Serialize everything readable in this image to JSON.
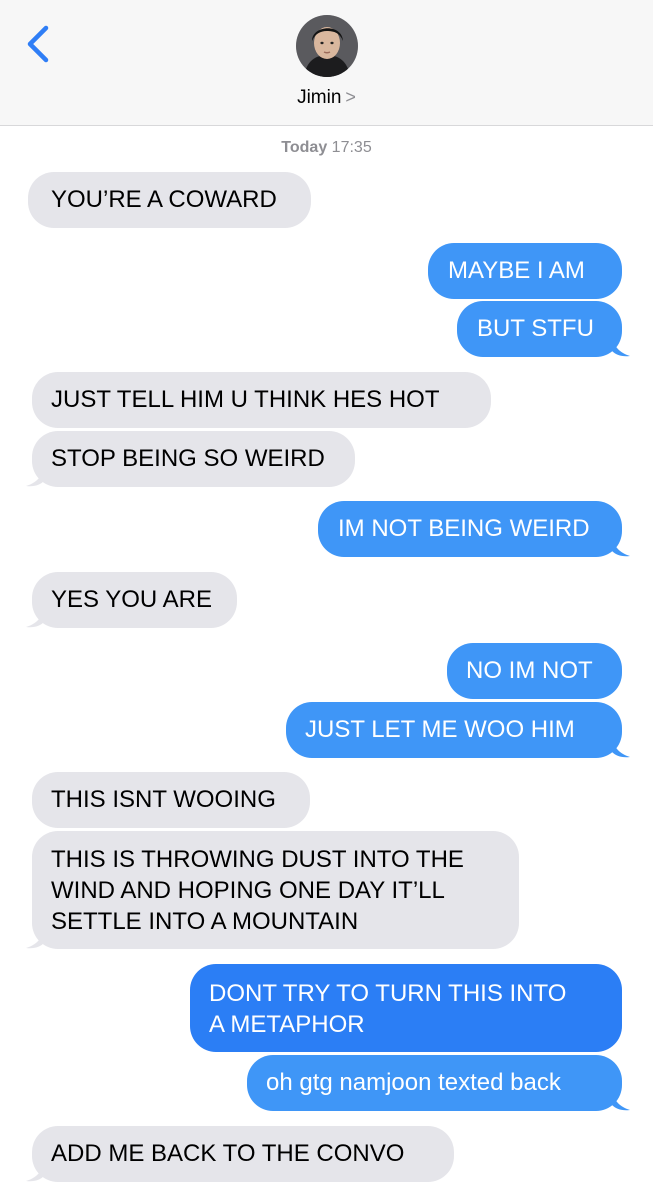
{
  "header": {
    "contact_name": "Jimin",
    "chevron": ">"
  },
  "timestamp": {
    "day": "Today",
    "time": "17:35"
  },
  "messages": [
    {
      "dir": "in",
      "text": "YOU’RE A COWARD"
    },
    {
      "dir": "out",
      "text": "MAYBE I AM"
    },
    {
      "dir": "out",
      "text": "BUT STFU"
    },
    {
      "dir": "in",
      "text": "JUST TELL HIM U THINK HES HOT"
    },
    {
      "dir": "in",
      "text": "STOP BEING SO WEIRD"
    },
    {
      "dir": "out",
      "text": "IM NOT BEING WEIRD"
    },
    {
      "dir": "in",
      "text": "YES YOU ARE"
    },
    {
      "dir": "out",
      "text": "NO IM NOT"
    },
    {
      "dir": "out",
      "text": "JUST LET ME WOO HIM"
    },
    {
      "dir": "in",
      "text": "THIS ISNT WOOING"
    },
    {
      "dir": "in",
      "lines": [
        "THIS IS THROWING DUST INTO THE",
        "WIND AND HOPING ONE DAY IT’LL",
        "SETTLE INTO A MOUNTAIN"
      ]
    },
    {
      "dir": "out",
      "lines": [
        "DONT TRY TO TURN THIS INTO",
        "A METAPHOR"
      ]
    },
    {
      "dir": "out",
      "text": "oh gtg namjoon texted back"
    },
    {
      "dir": "in",
      "text": "ADD ME BACK TO THE CONVO"
    }
  ],
  "colors": {
    "incoming_bubble": "#e5e5ea",
    "outgoing_bubble": "#3f96f7",
    "accent": "#2f7ef6"
  }
}
